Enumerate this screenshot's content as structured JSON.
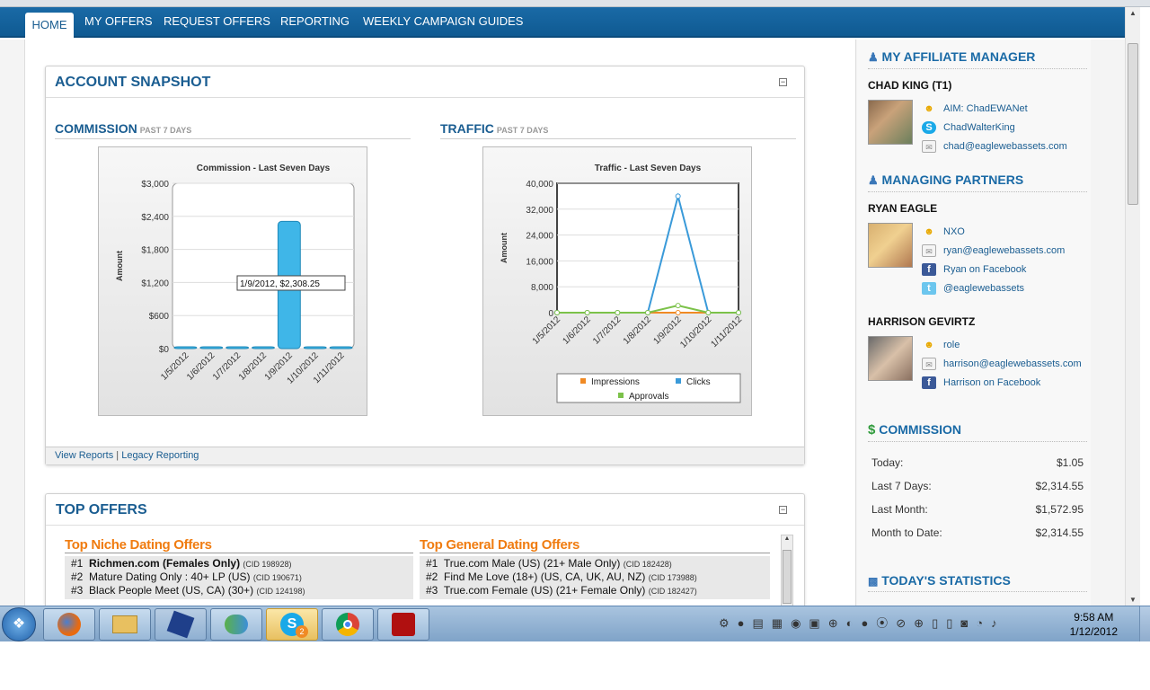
{
  "nav": {
    "home": "HOME",
    "items": [
      "MY OFFERS",
      "REQUEST OFFERS",
      "REPORTING",
      "WEEKLY CAMPAIGN GUIDES"
    ]
  },
  "snapshot": {
    "title": "ACCOUNT SNAPSHOT",
    "collapse": "−",
    "commission_head": "COMMISSION",
    "commission_sub": "PAST 7 DAYS",
    "traffic_head": "TRAFFIC",
    "traffic_sub": "PAST 7 DAYS",
    "footer_link1": "View Reports",
    "footer_sep": " | ",
    "footer_link2": "Legacy Reporting"
  },
  "chart_data": [
    {
      "type": "bar",
      "title": "Commission - Last Seven Days",
      "ylabel": "Amount",
      "xlabel": "",
      "categories": [
        "1/5/2012",
        "1/6/2012",
        "1/7/2012",
        "1/8/2012",
        "1/9/2012",
        "1/10/2012",
        "1/11/2012"
      ],
      "values": [
        0,
        0,
        0,
        0,
        2308.25,
        0,
        0
      ],
      "ylim": [
        0,
        3000
      ],
      "yticks": [
        "$0",
        "$600",
        "$1,200",
        "$1,800",
        "$2,400",
        "$3,000"
      ],
      "tooltip": "1/9/2012, $2,308.25",
      "grid": true,
      "colors": [
        "#3fb6e8"
      ]
    },
    {
      "type": "line",
      "title": "Traffic - Last Seven Days",
      "ylabel": "Amount",
      "xlabel": "",
      "categories": [
        "1/5/2012",
        "1/6/2012",
        "1/7/2012",
        "1/8/2012",
        "1/9/2012",
        "1/10/2012",
        "1/11/2012"
      ],
      "series": [
        {
          "name": "Impressions",
          "values": [
            0,
            0,
            0,
            0,
            0,
            0,
            0
          ],
          "color": "#f08a24"
        },
        {
          "name": "Clicks",
          "values": [
            0,
            0,
            0,
            0,
            36000,
            0,
            0
          ],
          "color": "#3a9ad9"
        },
        {
          "name": "Approvals",
          "values": [
            0,
            0,
            0,
            0,
            2200,
            0,
            0
          ],
          "color": "#7cc24a"
        }
      ],
      "ylim": [
        0,
        40000
      ],
      "yticks": [
        "0",
        "8,000",
        "16,000",
        "24,000",
        "32,000",
        "40,000"
      ],
      "legend": "bottom",
      "grid": true
    }
  ],
  "top_offers": {
    "title": "TOP OFFERS",
    "collapse": "−",
    "niche": {
      "heading": "Top Niche Dating Offers",
      "rows": [
        {
          "rank": "#1",
          "name": "Richmen.com (Females Only)",
          "cid": "(CID 198928)",
          "bold": true
        },
        {
          "rank": "#2",
          "name": "Mature Dating Only : 40+ LP (US)",
          "cid": "(CID 190671)",
          "bold": false
        },
        {
          "rank": "#3",
          "name": "Black People Meet (US, CA) (30+)",
          "cid": "(CID 124198)",
          "bold": false
        }
      ]
    },
    "general": {
      "heading": "Top General Dating Offers",
      "rows": [
        {
          "rank": "#1",
          "name": "True.com Male (US) (21+ Male Only)",
          "cid": "(CID 182428)"
        },
        {
          "rank": "#2",
          "name": "Find Me Love (18+) (US, CA, UK, AU, NZ)",
          "cid": "(CID 173988)"
        },
        {
          "rank": "#3",
          "name": "True.com Female (US) (21+ Female Only)",
          "cid": "(CID 182427)"
        }
      ]
    }
  },
  "sidebar": {
    "manager_head": "MY AFFILIATE MANAGER",
    "manager_name": "CHAD KING (T1)",
    "manager_contacts": [
      "AIM: ChadEWANet",
      "ChadWalterKing",
      "chad@eaglewebassets.com"
    ],
    "partners_head": "MANAGING PARTNERS",
    "partner1_name": "RYAN EAGLE",
    "partner1_contacts": [
      "NXO",
      "ryan@eaglewebassets.com",
      "Ryan on Facebook",
      "@eaglewebassets"
    ],
    "partner2_name": "HARRISON GEVIRTZ",
    "partner2_contacts": [
      "role",
      "harrison@eaglewebassets.com",
      "Harrison on Facebook"
    ],
    "commission_head": "COMMISSION",
    "commission_rows": [
      {
        "label": "Today:",
        "value": "$1.05"
      },
      {
        "label": "Last 7 Days:",
        "value": "$2,314.55"
      },
      {
        "label": "Last Month:",
        "value": "$1,572.95"
      },
      {
        "label": "Month to Date:",
        "value": "$2,314.55"
      }
    ],
    "stats_head": "TODAY'S STATISTICS"
  },
  "taskbar": {
    "time": "9:58 AM",
    "date": "1/12/2012",
    "skype_badge": "2"
  }
}
